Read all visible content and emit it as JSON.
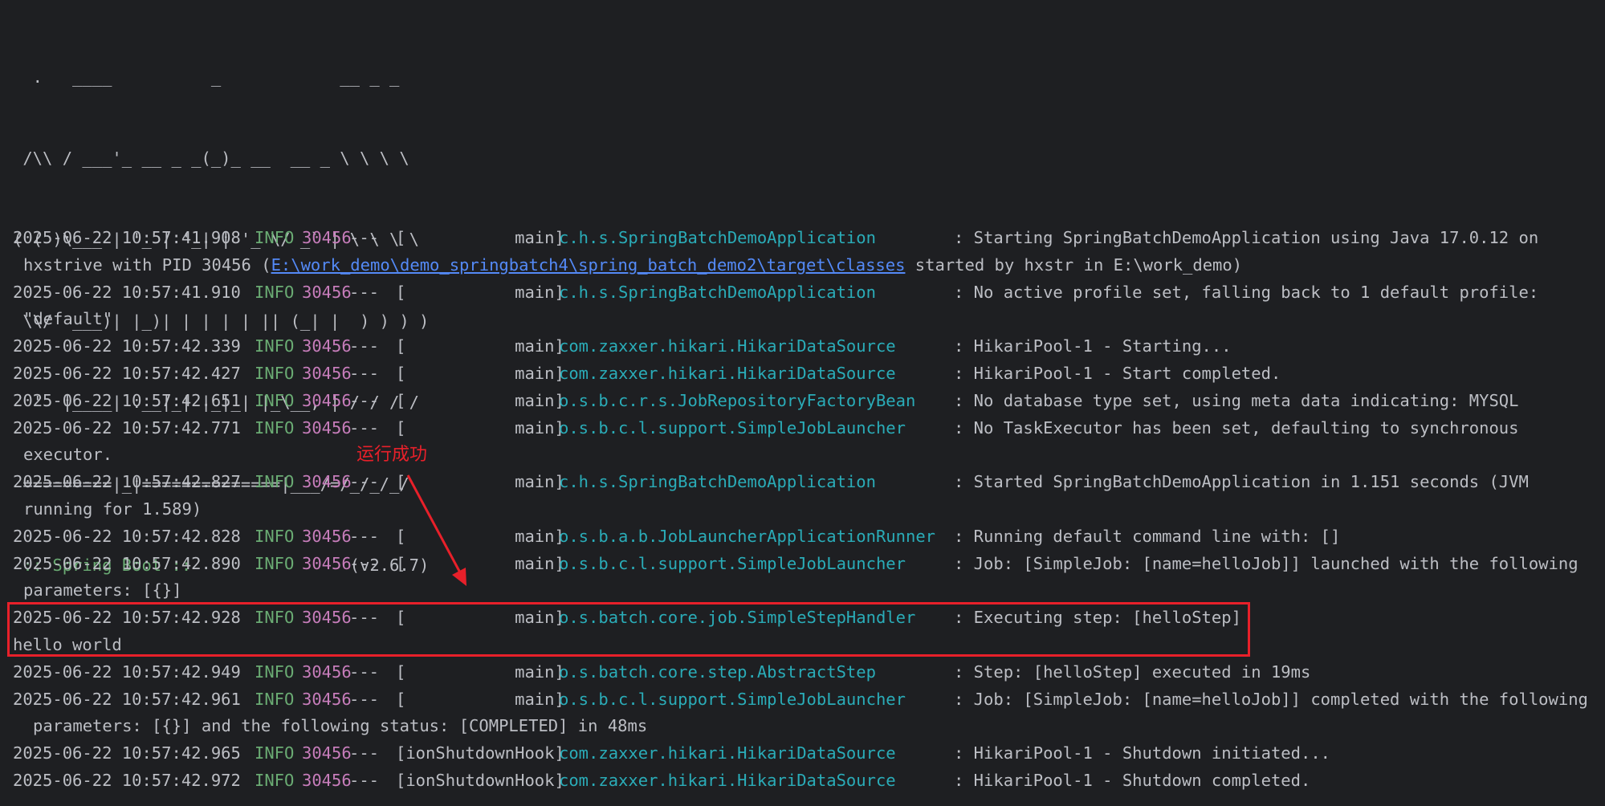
{
  "banner": {
    "art_lines": [
      "  .   ____          _            __ _ _",
      " /\\\\ / ___'_ __ _ _(_)_ __  __ _ \\ \\ \\ \\",
      "( ( )\\___ | '_ | '_| | '_ \\/ _` | \\ \\ \\ \\",
      " \\\\/  ___)| |_)| | | | | || (_| |  ) ) ) )",
      "  '  |____| .__|_| |_|_| |_\\__, | / / / /",
      " =========|_|==============|___/=/_/_/_/"
    ],
    "spring_label": " :: Spring Boot :: ",
    "version": "               (v2.6.7)"
  },
  "logs": [
    {
      "ts": "2025-06-22 10:57:41.908",
      "level": "INFO",
      "pid": "30456",
      "sep": "---",
      "thread": "[           main]",
      "logger": "c.h.s.SpringBatchDemoApplication",
      "msg": ": Starting SpringBatchDemoApplication using Java 17.0.12 on",
      "cont_pre": "hxstrive with PID 30456 (",
      "cont_link": "E:\\work_demo\\demo_springbatch4\\spring_batch_demo2\\target\\classes",
      "cont_post": " started by hxstr in E:\\work_demo)"
    },
    {
      "ts": "2025-06-22 10:57:41.910",
      "level": "INFO",
      "pid": "30456",
      "sep": "---",
      "thread": "[           main]",
      "logger": "c.h.s.SpringBatchDemoApplication",
      "msg": ": No active profile set, falling back to 1 default profile:",
      "cont": "\"default\""
    },
    {
      "ts": "2025-06-22 10:57:42.339",
      "level": "INFO",
      "pid": "30456",
      "sep": "---",
      "thread": "[           main]",
      "logger": "com.zaxxer.hikari.HikariDataSource",
      "msg": ": HikariPool-1 - Starting..."
    },
    {
      "ts": "2025-06-22 10:57:42.427",
      "level": "INFO",
      "pid": "30456",
      "sep": "---",
      "thread": "[           main]",
      "logger": "com.zaxxer.hikari.HikariDataSource",
      "msg": ": HikariPool-1 - Start completed."
    },
    {
      "ts": "2025-06-22 10:57:42.651",
      "level": "INFO",
      "pid": "30456",
      "sep": "---",
      "thread": "[           main]",
      "logger": "o.s.b.c.r.s.JobRepositoryFactoryBean",
      "msg": ": No database type set, using meta data indicating: MYSQL"
    },
    {
      "ts": "2025-06-22 10:57:42.771",
      "level": "INFO",
      "pid": "30456",
      "sep": "---",
      "thread": "[           main]",
      "logger": "o.s.b.c.l.support.SimpleJobLauncher",
      "msg": ": No TaskExecutor has been set, defaulting to synchronous",
      "cont": "executor."
    },
    {
      "ts": "2025-06-22 10:57:42.827",
      "level": "INFO",
      "pid": "30456",
      "sep": "---",
      "thread": "[           main]",
      "logger": "c.h.s.SpringBatchDemoApplication",
      "msg": ": Started SpringBatchDemoApplication in 1.151 seconds (JVM",
      "cont": "running for 1.589)"
    },
    {
      "ts": "2025-06-22 10:57:42.828",
      "level": "INFO",
      "pid": "30456",
      "sep": "---",
      "thread": "[           main]",
      "logger": "o.s.b.a.b.JobLauncherApplicationRunner",
      "msg": ": Running default command line with: []"
    },
    {
      "ts": "2025-06-22 10:57:42.890",
      "level": "INFO",
      "pid": "30456",
      "sep": "---",
      "thread": "[           main]",
      "logger": "o.s.b.c.l.support.SimpleJobLauncher",
      "msg": ": Job: [SimpleJob: [name=helloJob]] launched with the following",
      "cont": "parameters: [{}]"
    },
    {
      "ts": "2025-06-22 10:57:42.928",
      "level": "INFO",
      "pid": "30456",
      "sep": "---",
      "thread": "[           main]",
      "logger": "o.s.batch.core.job.SimpleStepHandler",
      "msg": ": Executing step: [helloStep]",
      "cont": "hello world"
    },
    {
      "ts": "2025-06-22 10:57:42.949",
      "level": "INFO",
      "pid": "30456",
      "sep": "---",
      "thread": "[           main]",
      "logger": "o.s.batch.core.step.AbstractStep",
      "msg": ": Step: [helloStep] executed in 19ms"
    },
    {
      "ts": "2025-06-22 10:57:42.961",
      "level": "INFO",
      "pid": "30456",
      "sep": "---",
      "thread": "[           main]",
      "logger": "o.s.b.c.l.support.SimpleJobLauncher",
      "msg": ": Job: [SimpleJob: [name=helloJob]] completed with the following",
      "cont": "parameters: [{}] and the following status: [COMPLETED] in 48ms"
    },
    {
      "ts": "2025-06-22 10:57:42.965",
      "level": "INFO",
      "pid": "30456",
      "sep": "---",
      "thread": "[ionShutdownHook]",
      "logger": "com.zaxxer.hikari.HikariDataSource",
      "msg": ": HikariPool-1 - Shutdown initiated..."
    },
    {
      "ts": "2025-06-22 10:57:42.972",
      "level": "INFO",
      "pid": "30456",
      "sep": "---",
      "thread": "[ionShutdownHook]",
      "logger": "com.zaxxer.hikari.HikariDataSource",
      "msg": ": HikariPool-1 - Shutdown completed."
    }
  ],
  "annotation": {
    "text": "运行成功",
    "color": "#e8202a"
  },
  "colors": {
    "background": "#1e1f22",
    "text": "#bcbec4",
    "level": "#6aab73",
    "pid": "#c77dbb",
    "logger": "#2aacb8",
    "link": "#548af7"
  }
}
